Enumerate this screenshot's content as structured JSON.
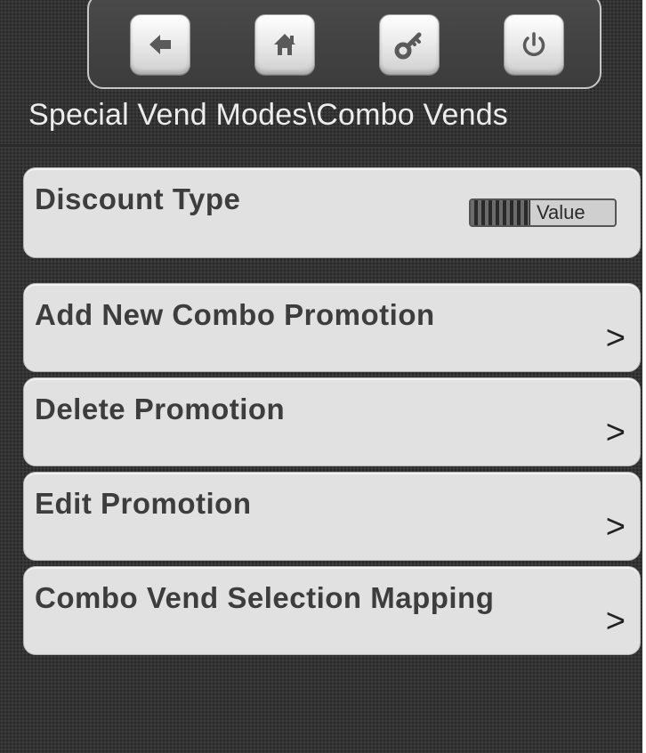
{
  "nav": {
    "buttons": [
      {
        "icon": "back-arrow-icon",
        "label": "Back"
      },
      {
        "icon": "home-icon",
        "label": "Home"
      },
      {
        "icon": "key-icon",
        "label": "Key"
      },
      {
        "icon": "power-icon",
        "label": "Power"
      }
    ]
  },
  "breadcrumb": "Special Vend Modes\\Combo Vends",
  "menu": {
    "discount_type": {
      "label": "Discount Type",
      "toggle_value": "Value"
    },
    "items": [
      {
        "label": "Add New Combo Promotion",
        "chevron": ">"
      },
      {
        "label": "Delete Promotion",
        "chevron": ">"
      },
      {
        "label": "Edit Promotion",
        "chevron": ">"
      },
      {
        "label": "Combo Vend Selection Mapping",
        "chevron": ">"
      }
    ]
  },
  "colors": {
    "background": "#333333",
    "card": "#e1e1e1",
    "label_text": "#3d3d3d",
    "title_text": "#ececec"
  }
}
